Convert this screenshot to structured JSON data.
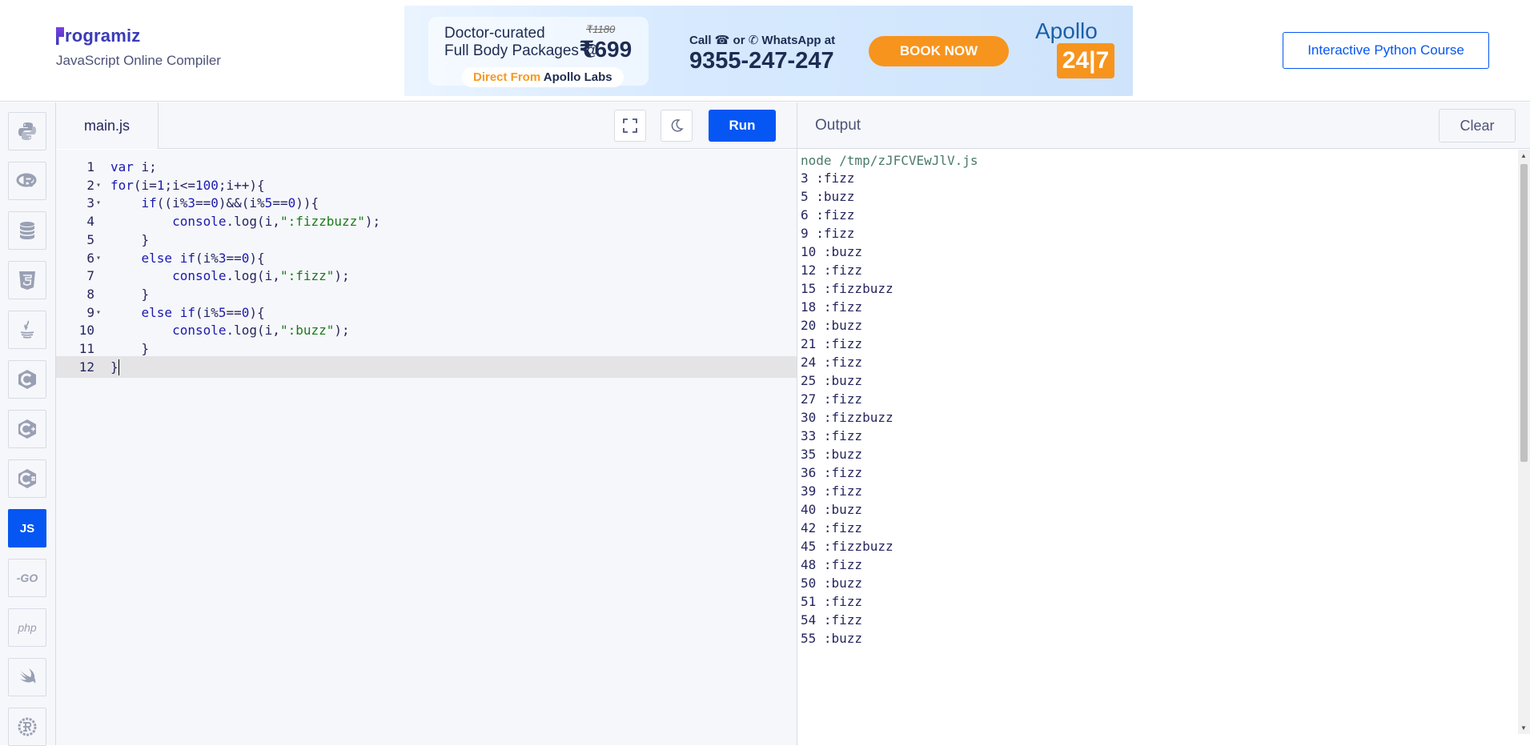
{
  "header": {
    "logo_text": "rogramiz",
    "subtitle": "JavaScript Online Compiler",
    "course_button": "Interactive Python Course"
  },
  "ad": {
    "headline_line1": "Doctor-curated",
    "headline_line2": "Full Body Packages @",
    "old_price": "₹1180",
    "price": "₹699",
    "pill_prefix": "Direct From ",
    "pill_brand": "Apollo Labs",
    "call_text": "Call ☎ or ✆ WhatsApp at",
    "phone": "9355-247-247",
    "cta": "BOOK NOW",
    "brand": "Apollo",
    "brand_number": "24|7"
  },
  "sidebar": {
    "languages": [
      {
        "name": "python",
        "icon": "python-icon"
      },
      {
        "name": "r",
        "icon": "r-icon"
      },
      {
        "name": "sql",
        "icon": "database-icon"
      },
      {
        "name": "html",
        "icon": "html5-icon"
      },
      {
        "name": "java",
        "icon": "java-icon"
      },
      {
        "name": "c",
        "icon": "c-icon"
      },
      {
        "name": "cpp",
        "icon": "cpp-icon"
      },
      {
        "name": "csharp",
        "icon": "csharp-icon"
      },
      {
        "name": "javascript",
        "label": "JS",
        "active": true
      },
      {
        "name": "go",
        "label": "-GO"
      },
      {
        "name": "php",
        "label": "php"
      },
      {
        "name": "swift",
        "icon": "swift-icon"
      },
      {
        "name": "rust",
        "icon": "rust-icon"
      }
    ]
  },
  "editor": {
    "file_tab": "main.js",
    "run_label": "Run",
    "active_line": 12,
    "lines": [
      {
        "n": "1",
        "fold": false
      },
      {
        "n": "2",
        "fold": true
      },
      {
        "n": "3",
        "fold": true
      },
      {
        "n": "4",
        "fold": false
      },
      {
        "n": "5",
        "fold": false
      },
      {
        "n": "6",
        "fold": true
      },
      {
        "n": "7",
        "fold": false
      },
      {
        "n": "8",
        "fold": false
      },
      {
        "n": "9",
        "fold": true
      },
      {
        "n": "10",
        "fold": false
      },
      {
        "n": "11",
        "fold": false
      },
      {
        "n": "12",
        "fold": false
      }
    ],
    "code": [
      "var i;",
      "for(i=1;i<=100;i++){",
      "    if((i%3==0)&&(i%5==0)){",
      "        console.log(i,\":fizzbuzz\");",
      "    }",
      "    else if(i%3==0){",
      "        console.log(i,\":fizz\");",
      "    }",
      "    else if(i%5==0){",
      "        console.log(i,\":buzz\");",
      "    }",
      "}"
    ]
  },
  "output": {
    "title": "Output",
    "clear_label": "Clear",
    "command": "node /tmp/zJFCVEwJlV.js",
    "lines": [
      "3 :fizz",
      "5 :buzz",
      "6 :fizz",
      "9 :fizz",
      "10 :buzz",
      "12 :fizz",
      "15 :fizzbuzz",
      "18 :fizz",
      "20 :buzz",
      "21 :fizz",
      "24 :fizz",
      "25 :buzz",
      "27 :fizz",
      "30 :fizzbuzz",
      "33 :fizz",
      "35 :buzz",
      "36 :fizz",
      "39 :fizz",
      "40 :buzz",
      "42 :fizz",
      "45 :fizzbuzz",
      "48 :fizz",
      "50 :buzz",
      "51 :fizz",
      "54 :fizz",
      "55 :buzz"
    ]
  },
  "colors": {
    "accent": "#0556f3",
    "editor_bg": "#f6f7fa",
    "keyword": "#1a1ab0",
    "string": "#1b7a1b"
  }
}
